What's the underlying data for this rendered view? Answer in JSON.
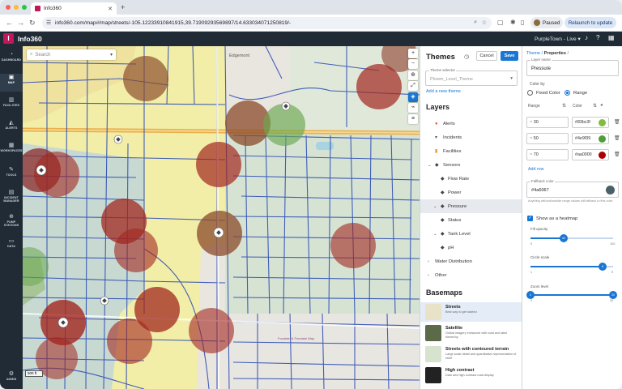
{
  "browser": {
    "tab_title": "Info360",
    "url": "info360.com/map#/map/streets/-105.12233910841915,39.71909293569897/14.633034071250819/-",
    "paused_label": "Paused",
    "relaunch_label": "Relaunch to update"
  },
  "app": {
    "logo_letter": "I",
    "title": "Info360",
    "org_label": "PurpleTown - Live"
  },
  "sidebar": {
    "items": [
      {
        "label": "DASHBOARD",
        "icon": "dashboard-icon",
        "glyph": "◔"
      },
      {
        "label": "MAP",
        "icon": "map-icon",
        "glyph": "▣"
      },
      {
        "label": "FACILITIES",
        "icon": "facilities-icon",
        "glyph": "▥"
      },
      {
        "label": "ALERTS",
        "icon": "bell-icon",
        "glyph": "◭"
      },
      {
        "label": "WORKSPACES",
        "icon": "workspaces-icon",
        "glyph": "▦"
      },
      {
        "label": "TOOLS",
        "icon": "tools-icon",
        "glyph": "✎"
      },
      {
        "label": "INCIDENT MANAGER",
        "icon": "incident-icon",
        "glyph": "▤"
      },
      {
        "label": "PUMP STATIONS",
        "icon": "pump-icon",
        "glyph": "⊕"
      },
      {
        "label": "DATA",
        "icon": "data-icon",
        "glyph": "▭"
      },
      {
        "label": "ADMIN",
        "icon": "gear-icon",
        "glyph": "⚙"
      }
    ]
  },
  "map": {
    "search_placeholder": "Search",
    "scale_label": "500 ft",
    "labels": {
      "edgemont": "Edgemont",
      "street_label": "Fountain & Fountain Way"
    }
  },
  "themes": {
    "title": "Themes",
    "cancel_label": "Cancel",
    "save_label": "Save",
    "selector_label": "Theme selector",
    "selector_value": "Plowm_Level_Theme",
    "add_theme_label": "Add a new theme",
    "layers_title": "Layers",
    "layers": [
      {
        "label": "Alerts",
        "icon": "alert-icon",
        "glyph": "●",
        "color": "#e25a2c"
      },
      {
        "label": "Incidents",
        "icon": "incident-icon",
        "glyph": "▾",
        "color": "#555555"
      },
      {
        "label": "Facilities",
        "icon": "facility-icon",
        "glyph": "▮",
        "color": "#e0922f"
      },
      {
        "label": "Sensors",
        "icon": "sensor-icon",
        "glyph": "◆",
        "color": "#444444"
      },
      {
        "label": "Flow Rate",
        "icon": "diamond-icon",
        "glyph": "◆",
        "color": "#444444"
      },
      {
        "label": "Power",
        "icon": "diamond-icon",
        "glyph": "◆",
        "color": "#444444"
      },
      {
        "label": "Pressure",
        "icon": "diamond-icon",
        "glyph": "◆",
        "color": "#444444"
      },
      {
        "label": "Status",
        "icon": "diamond-icon",
        "glyph": "◆",
        "color": "#444444"
      },
      {
        "label": "Tank Level",
        "icon": "diamond-icon",
        "glyph": "◆",
        "color": "#444444"
      },
      {
        "label": "pH",
        "icon": "diamond-icon",
        "glyph": "◆",
        "color": "#444444"
      },
      {
        "label": "Water Distribution",
        "icon": "",
        "glyph": "",
        "color": "#444444"
      },
      {
        "label": "Other",
        "icon": "",
        "glyph": "",
        "color": "#444444"
      }
    ],
    "basemaps_title": "Basemaps",
    "basemaps": [
      {
        "title": "Streets",
        "desc": "Best way to get started",
        "thumb_color": "#e8e2c8"
      },
      {
        "title": "Satellite",
        "desc": "Global imagery enhanced with road and label hierarchy",
        "thumb_color": "#5b6b4a"
      },
      {
        "title": "Streets with contoured terrain",
        "desc": "Large scale detail and quantitative representation of relief",
        "thumb_color": "#d8e3cf"
      },
      {
        "title": "High contrast",
        "desc": "Dark and high contrast road display",
        "thumb_color": "#222222"
      }
    ]
  },
  "properties": {
    "crumb_theme": "Theme",
    "crumb_sep": "/",
    "crumb_props": "Properties",
    "layer_name_label": "Layer name",
    "layer_name_value": "Pressure",
    "color_by_label": "Color by",
    "fixed_color_label": "Fixed Color",
    "range_label": "Range",
    "range_header": "Range",
    "color_header": "Color",
    "ranges": [
      {
        "value": "~ 30",
        "color": "#83bc3f"
      },
      {
        "value": "~ 50",
        "color": "#4e9f39"
      },
      {
        "value": "~ 70",
        "color": "#aa0000"
      }
    ],
    "add_row_label": "Add row",
    "fallback_label": "Fallback color",
    "fallback_value": "#4a6067",
    "fallback_hint": "Anything without/outside range values will fallback to this color",
    "heatmap_label": "Show as a heatmap",
    "heatmap_check": "✓",
    "fill_opacity_label": "Fill opacity",
    "fill_opacity_value": 40,
    "fill_opacity_min": "0",
    "fill_opacity_max": "100",
    "circle_scale_label": "Circle scale",
    "circle_scale_value": 8,
    "circle_scale_min": "1",
    "circle_scale_max": "9",
    "zoom_level_label": "Zoom level",
    "zoom_min_value": 0,
    "zoom_max_value": 20,
    "zoom_min": "0",
    "zoom_max": "20"
  }
}
